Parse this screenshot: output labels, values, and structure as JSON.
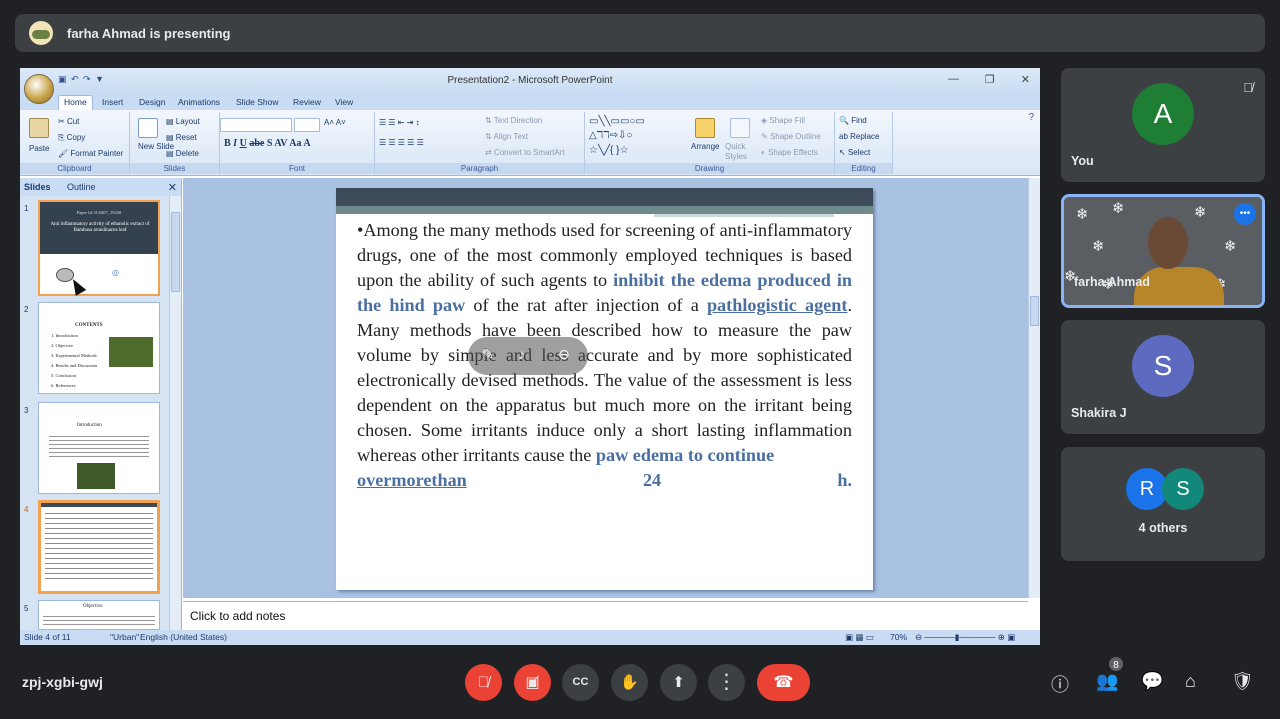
{
  "meeting": {
    "presenting_text": "farha Ahmad is presenting",
    "code": "zpj-xgbi-gwj",
    "people_count": "8"
  },
  "ppt": {
    "title": "Presentation2 - Microsoft PowerPoint",
    "tabs": [
      "Home",
      "Insert",
      "Design",
      "Animations",
      "Slide Show",
      "Review",
      "View"
    ],
    "clipboard": {
      "paste": "Paste",
      "cut": "Cut",
      "copy": "Copy",
      "format_painter": "Format Painter",
      "label": "Clipboard"
    },
    "slides_group": {
      "new_slide": "New Slide",
      "layout": "Layout",
      "reset": "Reset",
      "delete": "Delete",
      "label": "Slides"
    },
    "font_label": "Font",
    "paragraph": {
      "text_direction": "Text Direction",
      "align_text": "Align Text",
      "smartart": "Convert to SmartArt",
      "label": "Paragraph"
    },
    "drawing": {
      "arrange": "Arrange",
      "quick_styles": "Quick Styles",
      "shape_fill": "Shape Fill",
      "shape_outline": "Shape Outline",
      "shape_effects": "Shape Effects",
      "label": "Drawing"
    },
    "editing": {
      "find": "Find",
      "replace": "Replace",
      "select": "Select",
      "label": "Editing"
    },
    "panel_tabs": {
      "slides": "Slides",
      "outline": "Outline"
    },
    "thumbs": [
      {
        "num": "1",
        "line1": "Paper Id: IC0407_19438",
        "line2": "Anti inflammatory activity of ethanolic extract of Bambusa arundinacea leaf"
      },
      {
        "num": "2",
        "heading": "CONTENTS",
        "items": [
          "1. Introduction",
          "2. Objective",
          "3. Experimental Methods",
          "4. Results and Discussion",
          "5. Conclusion",
          "6. References"
        ]
      },
      {
        "num": "3",
        "heading": "Introduction"
      },
      {
        "num": "4"
      },
      {
        "num": "5",
        "heading": "Objective"
      }
    ],
    "slide_text": {
      "p1": "•Among the many methods used for screening of anti-inflammatory drugs, one of the most commonly employed techniques is based upon the ability of such agents to ",
      "b1": "inhibit the edema produced in the hind paw",
      "p2": " of the rat after injection of a ",
      "b2": "pathlogistic agent",
      "p3": ". Many methods have been described how to measure the paw volume by simple and less accurate and by more sophisticated electronically devised methods. The value of the assessment is less dependent on the apparatus but much more on the irritant being chosen. Some irritants induce only a short lasting inflammation whereas other irritants cause the ",
      "b3": "paw edema to continue",
      "b4": "overmorethan",
      "b5": "24",
      "b6": "h",
      "p4": "."
    },
    "notes_placeholder": "Click to add notes",
    "status": {
      "slide": "Slide 4 of 11",
      "theme": "\"Urban\"",
      "lang": "English (United States)",
      "zoom": "70%"
    }
  },
  "participants": [
    {
      "name": "You",
      "initial": "A",
      "color": "#1e7e34"
    },
    {
      "name": "farha Ahmad"
    },
    {
      "name": "Shakira J",
      "initial": "S",
      "color": "#5c6bc0"
    },
    {
      "name": "4 others",
      "initials": [
        "R",
        "S"
      ],
      "colors": [
        "#1a73e8",
        "#12887a"
      ]
    }
  ]
}
